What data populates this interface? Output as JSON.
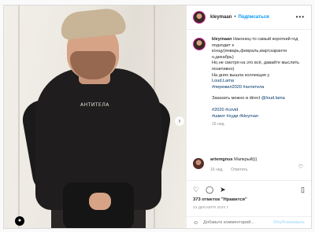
{
  "header": {
    "username": "kleymaan",
    "follow_label": "Подписаться",
    "more_icon": "•••"
  },
  "caption": {
    "username": "kleymaan",
    "text": "Наконец-то самый короткий год подходит к концу(январь,февраль,март,каранти н,декабрь)",
    "line2": "Но,не смотря на это всё, давайте мыслить позитивно)",
    "line3": "На днях вышла коллекция у",
    "line4_mention": "Loud.Lama",
    "hashtags1": "#пережил2020 #антитела",
    "order_text": "Заказать можно в direct",
    "order_mention": "@loud.lama",
    "hashtags2": "#2020 #covid",
    "hashtags3": "#шмот #худи #kleyman",
    "time": "16 нед."
  },
  "comment": {
    "username": "artemgnus",
    "text": "Мапкрый)))",
    "time": "16 нед.",
    "reply_label": "Ответить"
  },
  "stats": {
    "likes": "373 отметок \"Нравится\"",
    "date": "23 ДЕКАБРЯ 2020 Г."
  },
  "photo": {
    "print_text": "АНТИТЕЛА"
  },
  "add_comment": {
    "placeholder": "Добавьте комментарий...",
    "publish_label": "Опубликовать"
  },
  "colors": {
    "link": "#0095f6",
    "publish": "#b2dffc"
  }
}
